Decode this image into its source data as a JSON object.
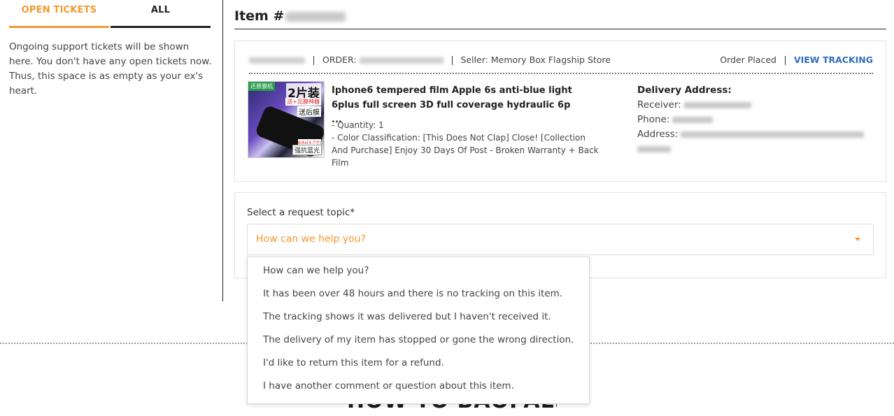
{
  "sidebar": {
    "tabs": [
      {
        "label": "OPEN TICKETS",
        "active": true
      },
      {
        "label": "ALL",
        "active": false
      }
    ],
    "empty_message": "Ongoing support tickets will be shown here. You don't have any open tickets now. Thus, this space is as empty as your ex's heart."
  },
  "item": {
    "title_prefix": "Item #"
  },
  "order": {
    "order_label": "ORDER:",
    "seller_label": "Seller: Memory Box Flagship Store",
    "status": "Order Placed",
    "view_tracking": "VIEW TRACKING"
  },
  "product": {
    "image": {
      "tag": "还原膜机",
      "big_text": "2片装",
      "sub_text": "送+见膜神器",
      "sub_text2": "送后膜",
      "badge_small": "6/6s(4.7寸)",
      "badge": "强抗蓝光"
    },
    "name": "Iphone6 tempered film Apple 6s anti-blue light 6plus full screen 3D full coverage hydraulic 6p ...",
    "quantity": "- Quantity: 1",
    "color_classification": "- Color Classification: [This Does Not Clap] Close! [Collection And Purchase] Enjoy 30 Days Of Post - Broken Warranty + Back Film"
  },
  "delivery": {
    "title": "Delivery Address:",
    "receiver_label": "Receiver:",
    "phone_label": "Phone:",
    "address_label": "Address:"
  },
  "request": {
    "label": "Select a request topic*",
    "selected": "How can we help you?",
    "options": [
      "How can we help you?",
      "It has been over 48 hours and there is no tracking on this item.",
      "The tracking shows it was delivered but I haven't received it.",
      "The delivery of my item has stopped or gone the wrong direction.",
      "I'd like to return this item for a refund.",
      "I have another comment or question about this item."
    ]
  },
  "footer": {
    "heading": "HOW TO BAOPALS"
  },
  "colors": {
    "accent": "#f29a2e",
    "link": "#2f6ebd",
    "text": "#333333"
  }
}
